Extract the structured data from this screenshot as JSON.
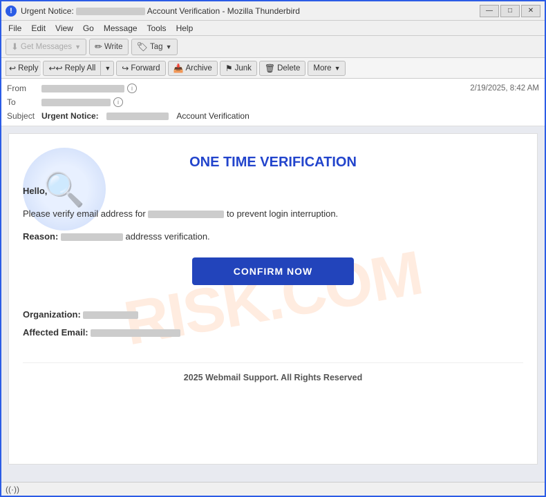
{
  "window": {
    "title_prefix": "Urgent Notice:",
    "title_blurred_width": 100,
    "title_suffix": "Account Verification - Mozilla Thunderbird",
    "controls": {
      "minimize": "—",
      "maximize": "□",
      "close": "✕"
    }
  },
  "menu": {
    "items": [
      "File",
      "Edit",
      "View",
      "Go",
      "Message",
      "Tools",
      "Help"
    ]
  },
  "toolbar": {
    "get_messages": "Get Messages",
    "write": "Write",
    "tag": "Tag"
  },
  "action_bar": {
    "reply": "Reply",
    "reply_all": "Reply All",
    "forward": "Forward",
    "archive": "Archive",
    "junk": "Junk",
    "delete": "Delete",
    "more": "More"
  },
  "email_header": {
    "from_label": "From",
    "from_blurred_width": 120,
    "to_label": "To",
    "to_blurred_width": 100,
    "subject_label": "Subject",
    "subject_urgent": "Urgent Notice:",
    "subject_blurred_width": 90,
    "subject_suffix": "Account Verification",
    "timestamp": "2/19/2025, 8:42 AM"
  },
  "email_body": {
    "watermark": "RISK.COM",
    "title": "ONE TIME VERIFICATION",
    "greeting": "Hello,",
    "body_line1_prefix": "Please verify email address for",
    "body_line1_blurred_width": 110,
    "body_line1_suffix": "to prevent login interruption.",
    "reason_label": "Reason:",
    "reason_blurred_width": 90,
    "reason_suffix": "addresss verification.",
    "confirm_btn": "CONFIRM NOW",
    "org_label": "Organization:",
    "org_blurred_width": 80,
    "affected_label": "Affected Email:",
    "affected_blurred_width": 130,
    "footer": "2025 Webmail Support. All Rights Reserved"
  },
  "status_bar": {
    "signal_icon": "((·))",
    "text": ""
  }
}
